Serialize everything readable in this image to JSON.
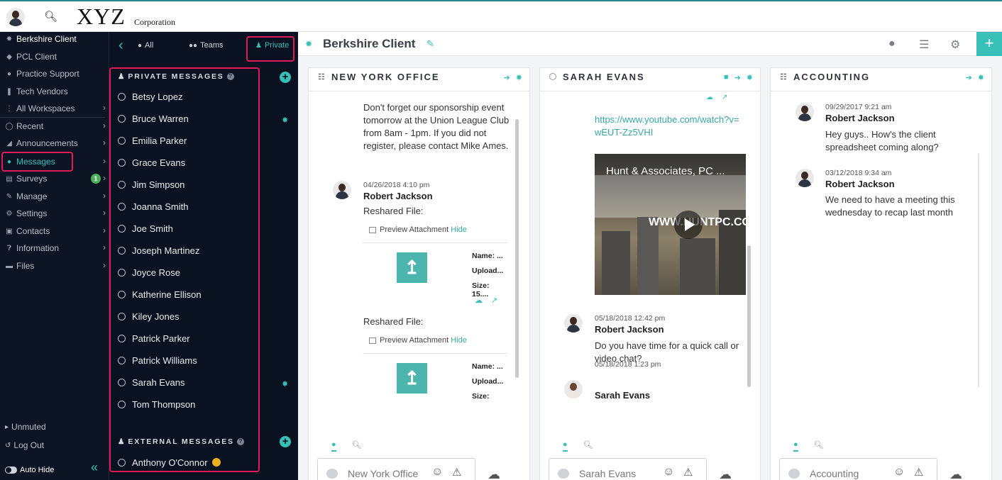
{
  "header": {
    "logo_text": "XYZ",
    "logo_sub": "Corporation",
    "search_icon": "search-icon"
  },
  "sidebar": {
    "items": [
      {
        "label": "Berkshire Client",
        "icon": "bug-icon"
      },
      {
        "label": "PCL Client",
        "icon": "cube-icon"
      },
      {
        "label": "Practice Support",
        "icon": "globe-icon"
      },
      {
        "label": "Tech Vendors",
        "icon": "wrench-icon"
      },
      {
        "label": "All Workspaces",
        "icon": "grid-icon"
      },
      {
        "label": "Recent",
        "icon": "clock-icon"
      },
      {
        "label": "Announcements",
        "icon": "megaphone-icon"
      },
      {
        "label": "Messages",
        "icon": "chat-icon"
      },
      {
        "label": "Surveys",
        "icon": "clipboard-icon",
        "badge": "1"
      },
      {
        "label": "Manage",
        "icon": "pencil-icon"
      },
      {
        "label": "Settings",
        "icon": "gear-icon"
      },
      {
        "label": "Contacts",
        "icon": "contact-card-icon"
      },
      {
        "label": "Information",
        "icon": "question-icon"
      },
      {
        "label": "Files",
        "icon": "folder-icon"
      }
    ],
    "unmuted": "Unmuted",
    "logout": "Log Out",
    "autohide": "Auto Hide"
  },
  "messages_panel": {
    "tabs": [
      {
        "label": "All"
      },
      {
        "label": "Teams"
      },
      {
        "label": "Private"
      }
    ],
    "private_heading": "PRIVATE MESSAGES",
    "contacts": [
      "Betsy Lopez",
      "Bruce Warren",
      "Emilia Parker",
      "Grace Evans",
      "Jim Simpson",
      "Joanna Smith",
      "Joe Smith",
      "Joseph Martinez",
      "Joyce Rose",
      "Katherine Ellison",
      "Kiley Jones",
      "Patrick Parker",
      "Patrick Williams",
      "Sarah Evans",
      "Tom Thompson"
    ],
    "external_heading": "EXTERNAL MESSAGES",
    "external_contacts": [
      "Anthony O'Connor"
    ]
  },
  "main": {
    "title": "Berkshire Client"
  },
  "columns": {
    "ny": {
      "title": "NEW YORK OFFICE",
      "msg1_text": "Don't forget our sponsorship event tomorrow at the Union League Club from 8am - 1pm.  If you did not register, please contact Mike Ames.",
      "msg2_meta": "04/26/2018 4:10 pm",
      "msg2_name": "Robert Jackson",
      "reshared": "Reshared File:",
      "preview": "Preview Attachment",
      "hide": "Hide",
      "file_name": "Name: ...",
      "file_upload": "Upload...",
      "file_size": "Size: 15....",
      "compose_placeholder": "New York Office"
    },
    "sarah": {
      "title": "SARAH EVANS",
      "link": "https://www.youtube.com/watch?v=wEUT-Zz5VHI",
      "video_title": "Hunt & Associates, PC ...",
      "video_overlay": "WWW.HUNTPC.CO",
      "msg1_meta": "05/18/2018 12:42 pm",
      "msg1_name": "Robert Jackson",
      "msg1_text": "Do you have time for a quick call or video chat?",
      "msg2_meta": "05/18/2018 1:23 pm",
      "msg2_name": "Sarah Evans",
      "compose_placeholder": "Sarah Evans"
    },
    "acct": {
      "title": "ACCOUNTING",
      "msg1_meta": "09/29/2017 9:21 am",
      "msg1_name": "Robert Jackson",
      "msg1_text": "Hey guys.. How's the client spreadsheet coming along?",
      "msg2_meta": "03/12/2018 9:34 am",
      "msg2_name": "Robert Jackson",
      "msg2_text": "We need to have a meeting this wednesday to recap last month",
      "compose_placeholder": "Accounting"
    }
  },
  "colors": {
    "accent": "#37c0b8",
    "highlight": "#e0195a",
    "nav_bg": "#0d1424"
  }
}
